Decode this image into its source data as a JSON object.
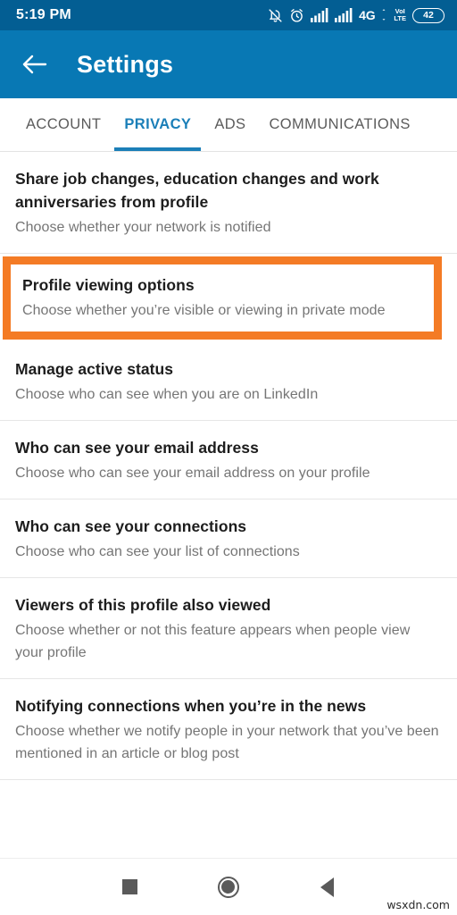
{
  "status_bar": {
    "time": "5:19 PM",
    "icons": [
      "bell-off-icon",
      "alarm-icon",
      "signal-bars-icon",
      "signal-bars-icon"
    ],
    "network_label": "4G",
    "volte_top": "VoI",
    "volte_bottom": "LTE",
    "battery_level": "42",
    "background_color": "#035E93"
  },
  "app_bar": {
    "back_icon": "back-arrow-icon",
    "title": "Settings",
    "background_color": "#0878B4"
  },
  "tabs": {
    "items": [
      {
        "label": "ACCOUNT",
        "active": false
      },
      {
        "label": "PRIVACY",
        "active": true
      },
      {
        "label": "ADS",
        "active": false
      },
      {
        "label": "COMMUNICATIONS",
        "active": false
      }
    ],
    "active_color": "#1B7FB8",
    "inactive_color": "#5B5B5B"
  },
  "settings": {
    "highlight_color": "#F47B25",
    "items": [
      {
        "title": "Share job changes, education changes and work anniversaries from profile",
        "subtitle": "Choose whether your network is notified",
        "highlighted": false
      },
      {
        "title": "Profile viewing options",
        "subtitle": "Choose whether you’re visible or viewing in private mode",
        "highlighted": true
      },
      {
        "title": "Manage active status",
        "subtitle": "Choose who can see when you are on LinkedIn",
        "highlighted": false
      },
      {
        "title": "Who can see your email address",
        "subtitle": "Choose who can see your email address on your profile",
        "highlighted": false
      },
      {
        "title": "Who can see your connections",
        "subtitle": "Choose who can see your list of connections",
        "highlighted": false
      },
      {
        "title": "Viewers of this profile also viewed",
        "subtitle": "Choose whether or not this feature appears when people view your profile",
        "highlighted": false
      },
      {
        "title": "Notifying connections when you’re in the news",
        "subtitle": "Choose whether we notify people in your network that you’ve been mentioned in an article or blog post",
        "highlighted": false
      }
    ]
  },
  "nav_bar": {
    "buttons": [
      {
        "name": "recents-square-icon"
      },
      {
        "name": "home-circle-icon"
      },
      {
        "name": "back-triangle-icon"
      }
    ]
  },
  "watermark": "wsxdn.com"
}
